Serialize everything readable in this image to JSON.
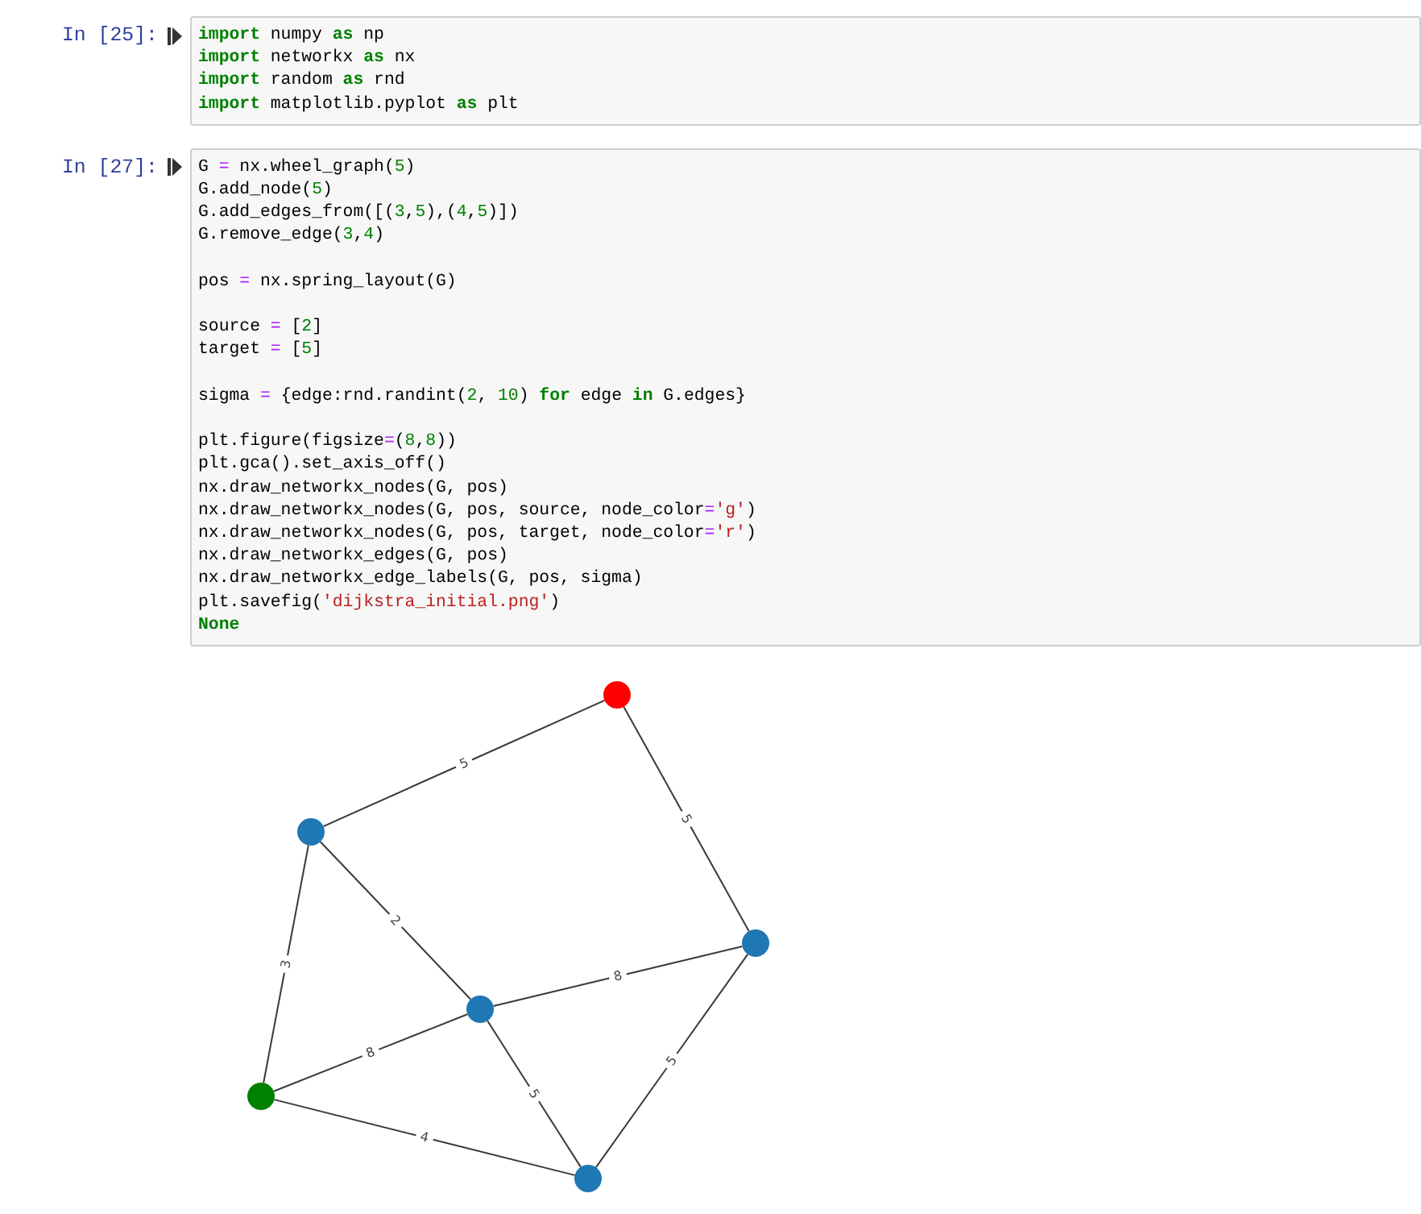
{
  "cells": [
    {
      "prompt": "In [25]:",
      "code_blocks": [
        [
          [
            {
              "kind": "keyword",
              "text": "import"
            },
            {
              "kind": "name",
              "text": " numpy "
            },
            {
              "kind": "keyword",
              "text": "as"
            },
            {
              "kind": "name",
              "text": " np"
            }
          ],
          [
            {
              "kind": "keyword",
              "text": "import"
            },
            {
              "kind": "name",
              "text": " networkx "
            },
            {
              "kind": "keyword",
              "text": "as"
            },
            {
              "kind": "name",
              "text": " nx"
            }
          ],
          [
            {
              "kind": "keyword",
              "text": "import"
            },
            {
              "kind": "name",
              "text": " random "
            },
            {
              "kind": "keyword",
              "text": "as"
            },
            {
              "kind": "name",
              "text": " rnd"
            }
          ],
          [
            {
              "kind": "keyword",
              "text": "import"
            },
            {
              "kind": "name",
              "text": " matplotlib.pyplot "
            },
            {
              "kind": "keyword",
              "text": "as"
            },
            {
              "kind": "name",
              "text": " plt"
            }
          ]
        ]
      ]
    },
    {
      "prompt": "In [27]:",
      "code_blocks": [
        [
          [
            {
              "kind": "name",
              "text": "G "
            },
            {
              "kind": "operator",
              "text": "="
            },
            {
              "kind": "name",
              "text": " nx.wheel_graph("
            },
            {
              "kind": "number",
              "text": "5"
            },
            {
              "kind": "name",
              "text": ")"
            }
          ],
          [
            {
              "kind": "name",
              "text": "G.add_node("
            },
            {
              "kind": "number",
              "text": "5"
            },
            {
              "kind": "name",
              "text": ")"
            }
          ],
          [
            {
              "kind": "name",
              "text": "G.add_edges_from([("
            },
            {
              "kind": "number",
              "text": "3"
            },
            {
              "kind": "name",
              "text": ","
            },
            {
              "kind": "number",
              "text": "5"
            },
            {
              "kind": "name",
              "text": "),("
            },
            {
              "kind": "number",
              "text": "4"
            },
            {
              "kind": "name",
              "text": ","
            },
            {
              "kind": "number",
              "text": "5"
            },
            {
              "kind": "name",
              "text": ")])"
            }
          ],
          [
            {
              "kind": "name",
              "text": "G.remove_edge("
            },
            {
              "kind": "number",
              "text": "3"
            },
            {
              "kind": "name",
              "text": ","
            },
            {
              "kind": "number",
              "text": "4"
            },
            {
              "kind": "name",
              "text": ")"
            }
          ]
        ],
        [
          [
            {
              "kind": "name",
              "text": "pos "
            },
            {
              "kind": "operator",
              "text": "="
            },
            {
              "kind": "name",
              "text": " nx.spring_layout(G)"
            }
          ]
        ],
        [
          [
            {
              "kind": "name",
              "text": "source "
            },
            {
              "kind": "operator",
              "text": "="
            },
            {
              "kind": "name",
              "text": " ["
            },
            {
              "kind": "number",
              "text": "2"
            },
            {
              "kind": "name",
              "text": "]"
            }
          ],
          [
            {
              "kind": "name",
              "text": "target "
            },
            {
              "kind": "operator",
              "text": "="
            },
            {
              "kind": "name",
              "text": " ["
            },
            {
              "kind": "number",
              "text": "5"
            },
            {
              "kind": "name",
              "text": "]"
            }
          ]
        ],
        [
          [
            {
              "kind": "name",
              "text": "sigma "
            },
            {
              "kind": "operator",
              "text": "="
            },
            {
              "kind": "name",
              "text": " {edge:rnd.randint("
            },
            {
              "kind": "number",
              "text": "2"
            },
            {
              "kind": "name",
              "text": ", "
            },
            {
              "kind": "number",
              "text": "10"
            },
            {
              "kind": "name",
              "text": ") "
            },
            {
              "kind": "keyword",
              "text": "for"
            },
            {
              "kind": "name",
              "text": " edge "
            },
            {
              "kind": "keyword",
              "text": "in"
            },
            {
              "kind": "name",
              "text": " G.edges}"
            }
          ]
        ],
        [
          [
            {
              "kind": "name",
              "text": "plt.figure(figsize"
            },
            {
              "kind": "operator",
              "text": "="
            },
            {
              "kind": "name",
              "text": "("
            },
            {
              "kind": "number",
              "text": "8"
            },
            {
              "kind": "name",
              "text": ","
            },
            {
              "kind": "number",
              "text": "8"
            },
            {
              "kind": "name",
              "text": "))"
            }
          ],
          [
            {
              "kind": "name",
              "text": "plt.gca().set_axis_off()"
            }
          ],
          [
            {
              "kind": "name",
              "text": "nx.draw_networkx_nodes(G, pos)"
            }
          ],
          [
            {
              "kind": "name",
              "text": "nx.draw_networkx_nodes(G, pos, source, node_color"
            },
            {
              "kind": "operator",
              "text": "="
            },
            {
              "kind": "string",
              "text": "'g'"
            },
            {
              "kind": "name",
              "text": ")"
            }
          ],
          [
            {
              "kind": "name",
              "text": "nx.draw_networkx_nodes(G, pos, target, node_color"
            },
            {
              "kind": "operator",
              "text": "="
            },
            {
              "kind": "string",
              "text": "'r'"
            },
            {
              "kind": "name",
              "text": ")"
            }
          ],
          [
            {
              "kind": "name",
              "text": "nx.draw_networkx_edges(G, pos)"
            }
          ],
          [
            {
              "kind": "name",
              "text": "nx.draw_networkx_edge_labels(G, pos, sigma)"
            }
          ],
          [
            {
              "kind": "name",
              "text": "plt.savefig("
            },
            {
              "kind": "string",
              "text": "'dijkstra_initial.png'"
            },
            {
              "kind": "name",
              "text": ")"
            }
          ],
          [
            {
              "kind": "keyword",
              "text": "None"
            }
          ]
        ]
      ],
      "output": {
        "graph": {
          "nodes": [
            {
              "color": "#ff0000"
            },
            {
              "color": "#1f77b4"
            },
            {
              "color": "#1f77b4"
            },
            {
              "color": "#1f77b4"
            },
            {
              "color": "#008000"
            },
            {
              "color": "#1f77b4"
            }
          ],
          "edges": [
            {
              "label": "5"
            },
            {
              "label": "5"
            },
            {
              "label": "2"
            },
            {
              "label": "3"
            },
            {
              "label": "8"
            },
            {
              "label": "8"
            },
            {
              "label": "5"
            },
            {
              "label": "5"
            },
            {
              "label": "4"
            }
          ]
        }
      }
    }
  ]
}
